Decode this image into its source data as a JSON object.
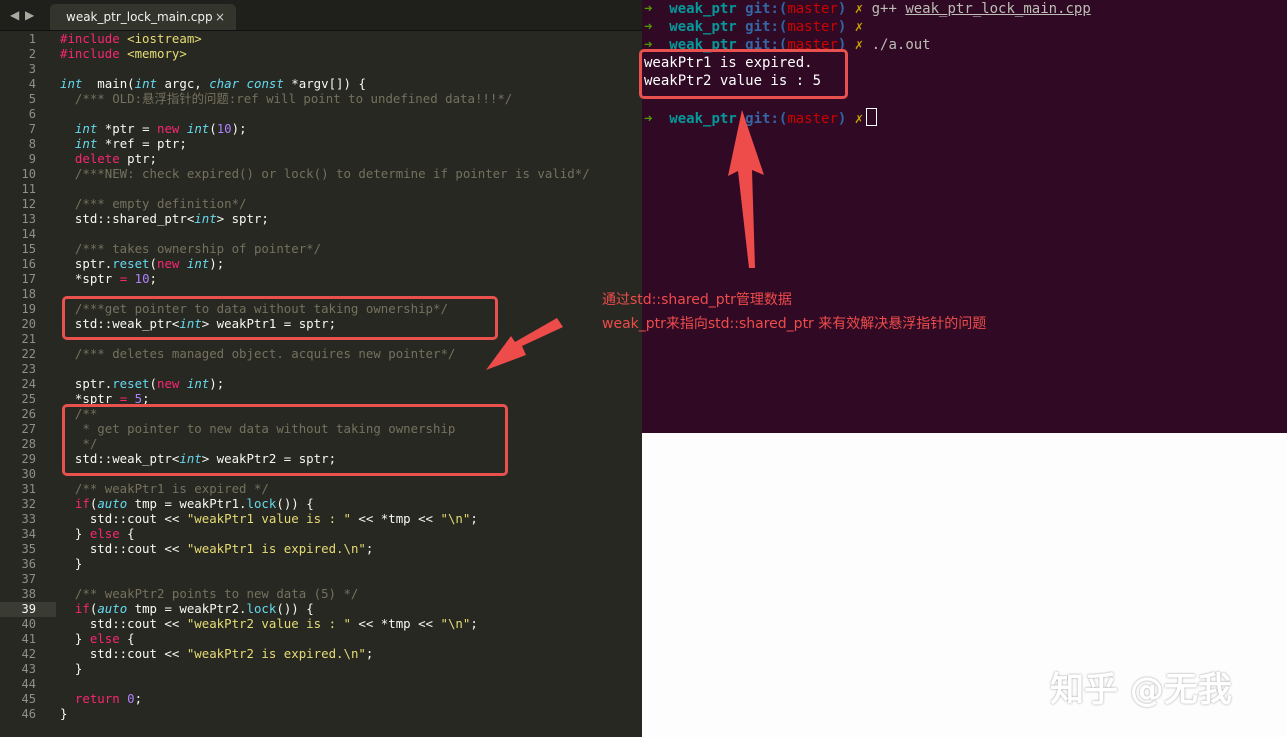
{
  "editor": {
    "nav_back": "◀",
    "nav_forward": "▶",
    "tab_title": "weak_ptr_lock_main.cpp",
    "tab_close": "×",
    "current_line": 39,
    "lines": [
      [
        [
          "pp",
          "#include "
        ],
        [
          "st",
          "<iostream>"
        ]
      ],
      [
        [
          "pp",
          "#include "
        ],
        [
          "st",
          "<memory>"
        ]
      ],
      [],
      [
        [
          "ty",
          "int"
        ],
        [
          "",
          "  main("
        ],
        [
          "ty",
          "int"
        ],
        [
          "",
          " argc, "
        ],
        [
          "ty",
          "char"
        ],
        [
          "",
          " "
        ],
        [
          "ty",
          "const"
        ],
        [
          "",
          " *argv[]) {"
        ]
      ],
      [
        [
          "",
          "  "
        ],
        [
          "cm",
          "/*** OLD:悬浮指针的问题:ref will point to undefined data!!!*/"
        ]
      ],
      [],
      [
        [
          "",
          "  "
        ],
        [
          "ty",
          "int"
        ],
        [
          "",
          " *ptr = "
        ],
        [
          "kw",
          "new"
        ],
        [
          "",
          " "
        ],
        [
          "ty",
          "int"
        ],
        [
          "",
          "("
        ],
        [
          "nm",
          "10"
        ],
        [
          "",
          ");"
        ]
      ],
      [
        [
          "",
          "  "
        ],
        [
          "ty",
          "int"
        ],
        [
          "",
          " *ref = ptr;"
        ]
      ],
      [
        [
          "",
          "  "
        ],
        [
          "kw",
          "delete"
        ],
        [
          "",
          " ptr;"
        ]
      ],
      [
        [
          "",
          "  "
        ],
        [
          "cm",
          "/***NEW: check expired() or lock() to determine if pointer is valid*/"
        ]
      ],
      [],
      [
        [
          "",
          "  "
        ],
        [
          "cm",
          "/*** empty definition*/"
        ]
      ],
      [
        [
          "",
          "  std::shared_ptr<"
        ],
        [
          "ty",
          "int"
        ],
        [
          "",
          "> sptr;"
        ]
      ],
      [],
      [
        [
          "",
          "  "
        ],
        [
          "cm",
          "/*** takes ownership of pointer*/"
        ]
      ],
      [
        [
          "",
          "  sptr."
        ],
        [
          "fn",
          "reset"
        ],
        [
          "",
          "("
        ],
        [
          "kw",
          "new"
        ],
        [
          "",
          " "
        ],
        [
          "ty",
          "int"
        ],
        [
          "",
          ");"
        ]
      ],
      [
        [
          "",
          "  *sptr "
        ],
        [
          "op",
          "="
        ],
        [
          "",
          " "
        ],
        [
          "nm",
          "10"
        ],
        [
          "",
          ";"
        ]
      ],
      [],
      [
        [
          "",
          "  "
        ],
        [
          "cm",
          "/***get pointer to data without taking ownership*/"
        ]
      ],
      [
        [
          "",
          "  std::weak_ptr<"
        ],
        [
          "ty",
          "int"
        ],
        [
          "",
          "> weakPtr1 = sptr;"
        ]
      ],
      [],
      [
        [
          "",
          "  "
        ],
        [
          "cm",
          "/*** deletes managed object. acquires new pointer*/"
        ]
      ],
      [],
      [
        [
          "",
          "  sptr."
        ],
        [
          "fn",
          "reset"
        ],
        [
          "",
          "("
        ],
        [
          "kw",
          "new"
        ],
        [
          "",
          " "
        ],
        [
          "ty",
          "int"
        ],
        [
          "",
          ");"
        ]
      ],
      [
        [
          "",
          "  *sptr "
        ],
        [
          "op",
          "="
        ],
        [
          "",
          " "
        ],
        [
          "nm",
          "5"
        ],
        [
          "",
          ";"
        ]
      ],
      [
        [
          "",
          "  "
        ],
        [
          "cm",
          "/**"
        ]
      ],
      [
        [
          "",
          "   "
        ],
        [
          "cm",
          "* get pointer to new data without taking ownership"
        ]
      ],
      [
        [
          "",
          "   "
        ],
        [
          "cm",
          "*/"
        ]
      ],
      [
        [
          "",
          "  std::weak_ptr<"
        ],
        [
          "ty",
          "int"
        ],
        [
          "",
          "> weakPtr2 = sptr;"
        ]
      ],
      [],
      [
        [
          "",
          "  "
        ],
        [
          "cm",
          "/** weakPtr1 is expired */"
        ]
      ],
      [
        [
          "",
          "  "
        ],
        [
          "kw",
          "if"
        ],
        [
          "",
          "("
        ],
        [
          "ty",
          "auto"
        ],
        [
          "",
          " tmp = weakPtr1."
        ],
        [
          "fn",
          "lock"
        ],
        [
          "",
          "()) {"
        ]
      ],
      [
        [
          "",
          "    std::cout << "
        ],
        [
          "st",
          "\"weakPtr1 value is : \""
        ],
        [
          "",
          " << *tmp << "
        ],
        [
          "st",
          "\"\\n\""
        ],
        [
          "",
          ";"
        ]
      ],
      [
        [
          "",
          "  } "
        ],
        [
          "kw",
          "else"
        ],
        [
          "",
          " {"
        ]
      ],
      [
        [
          "",
          "    std::cout << "
        ],
        [
          "st",
          "\"weakPtr1 is expired.\\n\""
        ],
        [
          "",
          ";"
        ]
      ],
      [
        [
          "",
          "  }"
        ]
      ],
      [],
      [
        [
          "",
          "  "
        ],
        [
          "cm",
          "/** weakPtr2 points to new data (5) */"
        ]
      ],
      [
        [
          "",
          "  "
        ],
        [
          "kw",
          "if"
        ],
        [
          "",
          "("
        ],
        [
          "ty",
          "auto"
        ],
        [
          "",
          " tmp = weakPtr2."
        ],
        [
          "fn",
          "lock"
        ],
        [
          "",
          "()) {"
        ]
      ],
      [
        [
          "",
          "    std::cout << "
        ],
        [
          "st",
          "\"weakPtr2 value is : \""
        ],
        [
          "",
          " << *tmp << "
        ],
        [
          "st",
          "\"\\n\""
        ],
        [
          "",
          ";"
        ]
      ],
      [
        [
          "",
          "  } "
        ],
        [
          "kw",
          "else"
        ],
        [
          "",
          " {"
        ]
      ],
      [
        [
          "",
          "    std::cout << "
        ],
        [
          "st",
          "\"weakPtr2 is expired.\\n\""
        ],
        [
          "",
          ";"
        ]
      ],
      [
        [
          "",
          "  }"
        ]
      ],
      [],
      [
        [
          "",
          "  "
        ],
        [
          "kw",
          "return"
        ],
        [
          "",
          " "
        ],
        [
          "nm",
          "0"
        ],
        [
          "",
          ";"
        ]
      ],
      [
        [
          "",
          "}"
        ]
      ]
    ]
  },
  "terminal": {
    "lines": [
      [
        [
          "t-arrow",
          "➜  "
        ],
        [
          "t-dir",
          "weak_ptr "
        ],
        [
          "t-git",
          "git:("
        ],
        [
          "t-br",
          "master"
        ],
        [
          "t-git",
          ") "
        ],
        [
          "t-x",
          "✗ "
        ],
        [
          "t-cmd",
          "g++ "
        ],
        [
          "t-cmd t-ul",
          "weak_ptr_lock_main.cpp"
        ]
      ],
      [
        [
          "t-arrow",
          "➜  "
        ],
        [
          "t-dir",
          "weak_ptr "
        ],
        [
          "t-git",
          "git:("
        ],
        [
          "t-br",
          "master"
        ],
        [
          "t-git",
          ") "
        ],
        [
          "t-x",
          "✗"
        ]
      ],
      [
        [
          "t-arrow",
          "➜  "
        ],
        [
          "t-dir",
          "weak_ptr "
        ],
        [
          "t-git",
          "git:("
        ],
        [
          "t-br",
          "master"
        ],
        [
          "t-git",
          ") "
        ],
        [
          "t-x",
          "✗ "
        ],
        [
          "t-cmd",
          "./a.out"
        ]
      ],
      [
        [
          "",
          "weakPtr1 is expired."
        ]
      ],
      [
        [
          "",
          "weakPtr2 value is : 5"
        ]
      ],
      [],
      [
        [
          "t-arrow",
          "➜  "
        ],
        [
          "t-dir",
          "weak_ptr "
        ],
        [
          "t-git",
          "git:("
        ],
        [
          "t-br",
          "master"
        ],
        [
          "t-git",
          ") "
        ],
        [
          "t-x",
          "✗"
        ],
        [
          "cursor",
          ""
        ]
      ]
    ]
  },
  "annotation": {
    "line1": "通过std::shared_ptr管理数据",
    "line2": "weak_ptr来指向std::shared_ptr 来有效解决悬浮指针的问题"
  },
  "watermark": "知乎 @无我",
  "colors": {
    "editor_bg": "#272822",
    "terminal_bg": "#300a24",
    "highlight_red": "#e9514f"
  }
}
